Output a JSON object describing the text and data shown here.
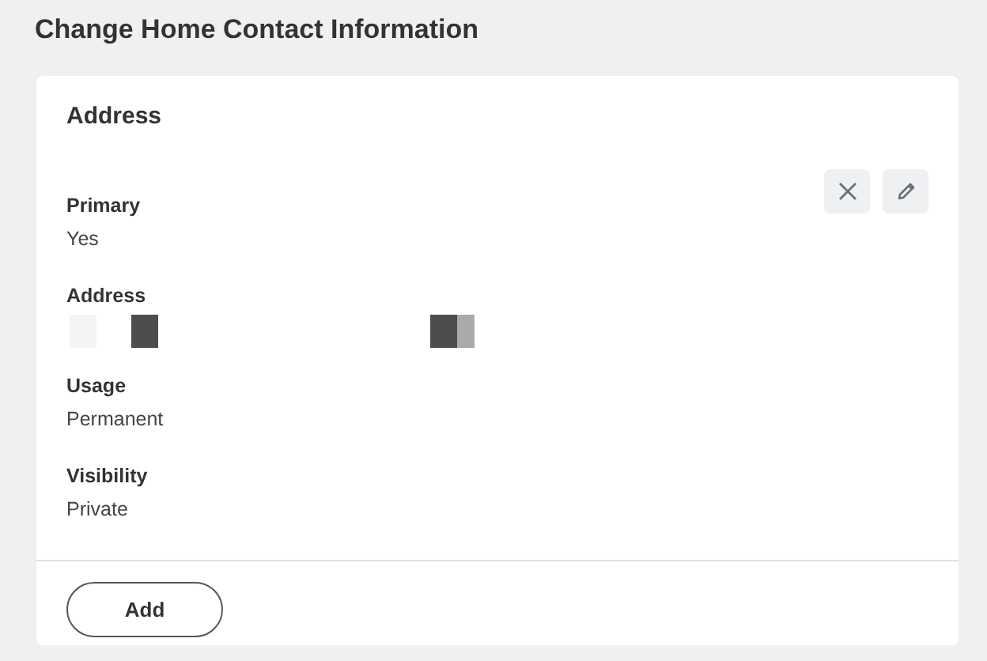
{
  "page_title": "Change Home Contact Information",
  "card": {
    "title": "Address",
    "actions": [
      {
        "kind": "close"
      },
      {
        "kind": "edit"
      }
    ],
    "fields": [
      {
        "label": "Primary",
        "value": "Yes"
      },
      {
        "label": "Address",
        "kind": "redacted"
      },
      {
        "label": "Usage",
        "value": "Permanent"
      },
      {
        "label": "Visibility",
        "value": "Private"
      }
    ],
    "footer_button": "Add"
  }
}
